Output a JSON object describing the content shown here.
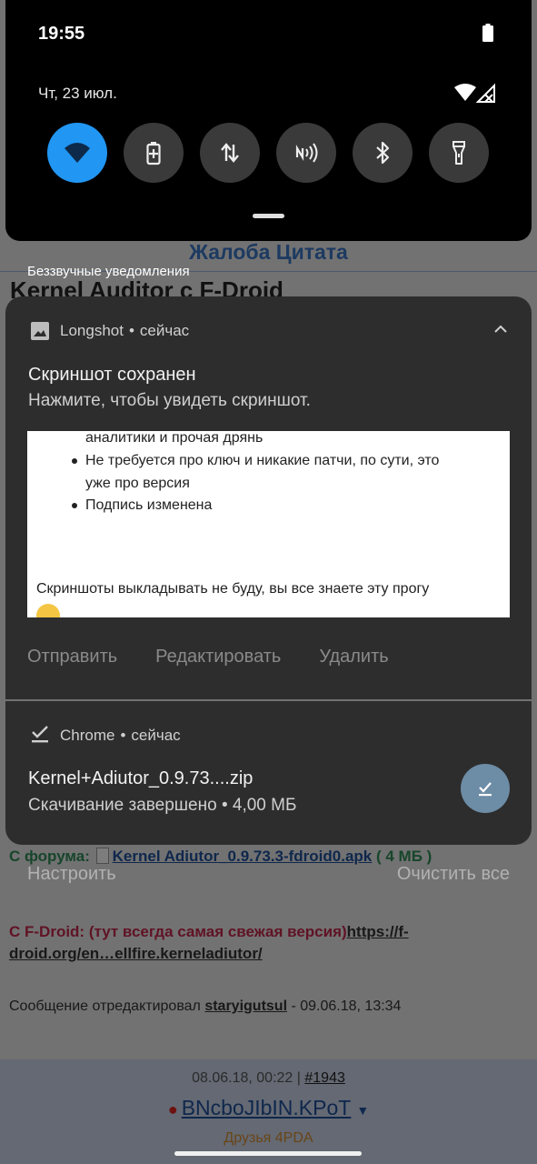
{
  "status_bar": {
    "time": "19:55",
    "battery_icon": "battery-full-icon"
  },
  "shade": {
    "date": "Чт, 23 июл.",
    "status_icons": [
      "wifi-icon",
      "no-signal-icon"
    ],
    "quick_tiles": [
      {
        "name": "wifi",
        "icon": "wifi-icon",
        "active": true
      },
      {
        "name": "battery-saver",
        "icon": "battery-saver-icon",
        "active": false
      },
      {
        "name": "mobile-data",
        "icon": "data-transfer-icon",
        "active": false
      },
      {
        "name": "nfc",
        "icon": "nfc-icon",
        "active": false
      },
      {
        "name": "bluetooth",
        "icon": "bluetooth-icon",
        "active": false
      },
      {
        "name": "flashlight",
        "icon": "flashlight-icon",
        "active": false
      }
    ],
    "accent_color": "#2196f3"
  },
  "silent_section": {
    "header": "Беззвучные уведомления"
  },
  "notification_longshot": {
    "app_name": "Longshot",
    "time": "сейчас",
    "title": "Скриншот сохранен",
    "text": "Нажмите, чтобы увидеть скриншот.",
    "preview": {
      "lines": [
        "аналитики и прочая дрянь",
        "Не требуется про ключ и никакие патчи, по сути, это",
        "уже про версия",
        "Подпись изменена"
      ],
      "paragraph": "Скриншоты выкладывать не буду, вы все знаете эту прогу"
    },
    "actions": {
      "send": "Отправить",
      "edit": "Редактировать",
      "delete": "Удалить"
    }
  },
  "notification_chrome": {
    "app_name": "Chrome",
    "time": "сейчас",
    "title": "Kernel+Adiutor_0.9.73....zip",
    "text": "Скачивание завершено • 4,00 МБ"
  },
  "shade_footer": {
    "settings": "Настроить",
    "clear_all": "Очистить все"
  },
  "web_page": {
    "top_links": "Жалоба Цитата",
    "heading": "Kernel Auditor с F-Droid",
    "forum_label": "С форума:",
    "forum_link": "Kernel Adiutor_0.9.73.3-fdroid0.apk",
    "forum_size": "( 4 МБ )",
    "fdroid_label": "С F-Droid: (тут всегда самая свежая версия)",
    "fdroid_link_1": "https://f-",
    "fdroid_link_2": "droid.org/en…ellfire.kerneladiutor/",
    "edit_prefix": "Сообщение отредактировал",
    "edit_user": "staryigutsul",
    "edit_date": "- 09.06.18, 13:34",
    "post_date": "08.06.18, 00:22 |",
    "post_number": "#1943",
    "post_author": "BNcboJIbIN.KPoT",
    "post_status": "Друзья 4PDA"
  }
}
